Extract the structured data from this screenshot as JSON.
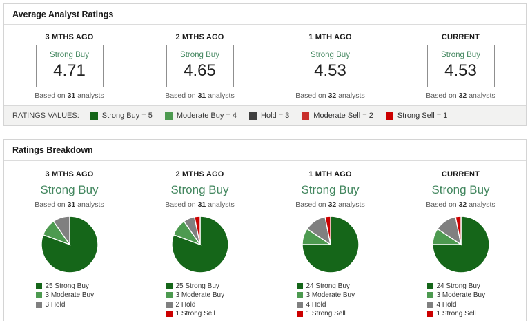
{
  "strings": {
    "based_on": "Based on",
    "analysts": "analysts"
  },
  "colors": {
    "strong_buy_green": "#156619",
    "moderate_buy_green": "#4d9a50",
    "hold_gray": "#808080",
    "hold_dark_gray": "#3f3f3f",
    "moderate_sell_red": "#c9302c",
    "strong_sell_red": "#cc0000",
    "rating_text_green": "#43875f"
  },
  "panels": {
    "avg": {
      "title": "Average Analyst Ratings",
      "cards": [
        {
          "period": "3 MTHS AGO",
          "rating": "Strong Buy",
          "value": "4.71",
          "analysts": "31"
        },
        {
          "period": "2 MTHS AGO",
          "rating": "Strong Buy",
          "value": "4.65",
          "analysts": "31"
        },
        {
          "period": "1 MTH AGO",
          "rating": "Strong Buy",
          "value": "4.53",
          "analysts": "32"
        },
        {
          "period": "CURRENT",
          "rating": "Strong Buy",
          "value": "4.53",
          "analysts": "32"
        }
      ],
      "legend": {
        "label": "RATINGS VALUES:",
        "items": [
          {
            "label": "Strong Buy = 5",
            "color": "#156619"
          },
          {
            "label": "Moderate Buy = 4",
            "color": "#4d9a50"
          },
          {
            "label": "Hold = 3",
            "color": "#3f3f3f"
          },
          {
            "label": "Moderate Sell = 2",
            "color": "#c9302c"
          },
          {
            "label": "Strong Sell = 1",
            "color": "#cc0000"
          }
        ]
      }
    },
    "breakdown": {
      "title": "Ratings Breakdown",
      "columns": [
        {
          "period": "3 MTHS AGO",
          "rating": "Strong Buy",
          "analysts": "31",
          "slices": [
            {
              "label": "25 Strong Buy",
              "value": 25,
              "color": "#156619"
            },
            {
              "label": "3 Moderate Buy",
              "value": 3,
              "color": "#4d9a50"
            },
            {
              "label": "3 Hold",
              "value": 3,
              "color": "#808080"
            }
          ]
        },
        {
          "period": "2 MTHS AGO",
          "rating": "Strong Buy",
          "analysts": "31",
          "slices": [
            {
              "label": "25 Strong Buy",
              "value": 25,
              "color": "#156619"
            },
            {
              "label": "3 Moderate Buy",
              "value": 3,
              "color": "#4d9a50"
            },
            {
              "label": "2 Hold",
              "value": 2,
              "color": "#808080"
            },
            {
              "label": "1 Strong Sell",
              "value": 1,
              "color": "#cc0000"
            }
          ]
        },
        {
          "period": "1 MTH AGO",
          "rating": "Strong Buy",
          "analysts": "32",
          "slices": [
            {
              "label": "24 Strong Buy",
              "value": 24,
              "color": "#156619"
            },
            {
              "label": "3 Moderate Buy",
              "value": 3,
              "color": "#4d9a50"
            },
            {
              "label": "4 Hold",
              "value": 4,
              "color": "#808080"
            },
            {
              "label": "1 Strong Sell",
              "value": 1,
              "color": "#cc0000"
            }
          ]
        },
        {
          "period": "CURRENT",
          "rating": "Strong Buy",
          "analysts": "32",
          "slices": [
            {
              "label": "24 Strong Buy",
              "value": 24,
              "color": "#156619"
            },
            {
              "label": "3 Moderate Buy",
              "value": 3,
              "color": "#4d9a50"
            },
            {
              "label": "4 Hold",
              "value": 4,
              "color": "#808080"
            },
            {
              "label": "1 Strong Sell",
              "value": 1,
              "color": "#cc0000"
            }
          ]
        }
      ]
    }
  },
  "chart_data": [
    {
      "type": "table",
      "title": "Average Analyst Ratings",
      "categories": [
        "3 MTHS AGO",
        "2 MTHS AGO",
        "1 MTH AGO",
        "CURRENT"
      ],
      "values": [
        4.71,
        4.65,
        4.53,
        4.53
      ],
      "analyst_counts": [
        31,
        31,
        32,
        32
      ],
      "consensus_labels": [
        "Strong Buy",
        "Strong Buy",
        "Strong Buy",
        "Strong Buy"
      ],
      "scale": "Strong Buy = 5, Moderate Buy = 4, Hold = 3, Moderate Sell = 2, Strong Sell = 1"
    },
    {
      "type": "pie",
      "title": "3 MTHS AGO",
      "subtitle": "Strong Buy",
      "total": 31,
      "labels": [
        "Strong Buy",
        "Moderate Buy",
        "Hold"
      ],
      "values": [
        25,
        3,
        3
      ],
      "legend_position": "bottom"
    },
    {
      "type": "pie",
      "title": "2 MTHS AGO",
      "subtitle": "Strong Buy",
      "total": 31,
      "labels": [
        "Strong Buy",
        "Moderate Buy",
        "Hold",
        "Strong Sell"
      ],
      "values": [
        25,
        3,
        2,
        1
      ],
      "legend_position": "bottom"
    },
    {
      "type": "pie",
      "title": "1 MTH AGO",
      "subtitle": "Strong Buy",
      "total": 32,
      "labels": [
        "Strong Buy",
        "Moderate Buy",
        "Hold",
        "Strong Sell"
      ],
      "values": [
        24,
        3,
        4,
        1
      ],
      "legend_position": "bottom"
    },
    {
      "type": "pie",
      "title": "CURRENT",
      "subtitle": "Strong Buy",
      "total": 32,
      "labels": [
        "Strong Buy",
        "Moderate Buy",
        "Hold",
        "Strong Sell"
      ],
      "values": [
        24,
        3,
        4,
        1
      ],
      "legend_position": "bottom"
    }
  ]
}
